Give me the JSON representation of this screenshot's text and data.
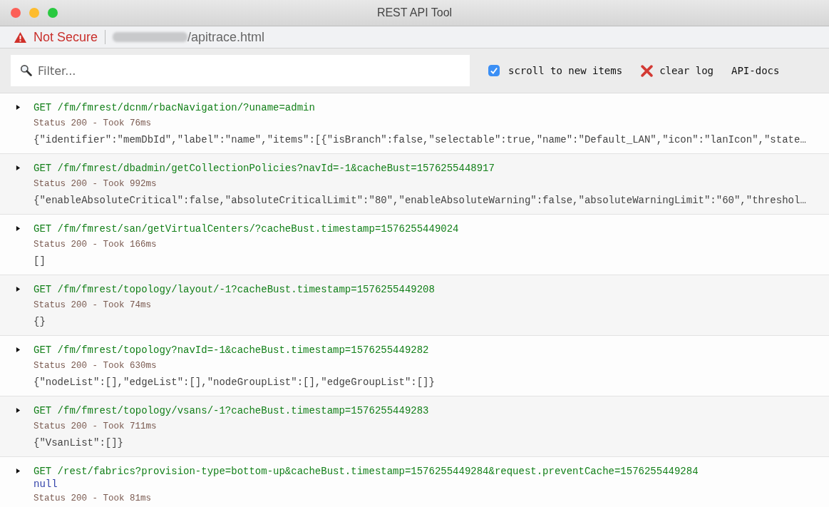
{
  "window": {
    "title": "REST API Tool"
  },
  "address_bar": {
    "security_label": "Not Secure",
    "path": "/apitrace.html"
  },
  "toolbar": {
    "filter": {
      "placeholder": "Filter..."
    },
    "scroll_checkbox": {
      "label": "scroll to new items",
      "checked": true
    },
    "clear_button": {
      "label": "clear log"
    },
    "docs_link": {
      "label": "API-docs"
    }
  },
  "entries": [
    {
      "expanded": false,
      "lines": [
        {
          "kind": "request",
          "text": "GET /fm/fmrest/dcnm/rbacNavigation/?uname=admin"
        },
        {
          "kind": "status",
          "text": "Status 200 - Took 76ms"
        },
        {
          "kind": "body",
          "text": "{\"identifier\":\"memDbId\",\"label\":\"name\",\"items\":[{\"isBranch\":false,\"selectable\":true,\"name\":\"Default_LAN\",\"icon\":\"lanIcon\",\"state…"
        }
      ]
    },
    {
      "expanded": false,
      "lines": [
        {
          "kind": "request",
          "text": "GET /fm/fmrest/dbadmin/getCollectionPolicies?navId=-1&cacheBust=1576255448917"
        },
        {
          "kind": "status",
          "text": "Status 200 - Took 992ms"
        },
        {
          "kind": "body",
          "text": "{\"enableAbsoluteCritical\":false,\"absoluteCriticalLimit\":\"80\",\"enableAbsoluteWarning\":false,\"absoluteWarningLimit\":\"60\",\"threshol…"
        }
      ]
    },
    {
      "expanded": false,
      "lines": [
        {
          "kind": "request",
          "text": "GET /fm/fmrest/san/getVirtualCenters/?cacheBust.timestamp=1576255449024"
        },
        {
          "kind": "status",
          "text": "Status 200 - Took 166ms"
        },
        {
          "kind": "body",
          "text": "[]"
        }
      ]
    },
    {
      "expanded": false,
      "lines": [
        {
          "kind": "request",
          "text": "GET /fm/fmrest/topology/layout/-1?cacheBust.timestamp=1576255449208"
        },
        {
          "kind": "status",
          "text": "Status 200 - Took 74ms"
        },
        {
          "kind": "body",
          "text": "{}"
        }
      ]
    },
    {
      "expanded": false,
      "lines": [
        {
          "kind": "request",
          "text": "GET /fm/fmrest/topology?navId=-1&cacheBust.timestamp=1576255449282"
        },
        {
          "kind": "status",
          "text": "Status 200 - Took 630ms"
        },
        {
          "kind": "body",
          "text": "{\"nodeList\":[],\"edgeList\":[],\"nodeGroupList\":[],\"edgeGroupList\":[]}"
        }
      ]
    },
    {
      "expanded": false,
      "lines": [
        {
          "kind": "request",
          "text": "GET /fm/fmrest/topology/vsans/-1?cacheBust.timestamp=1576255449283"
        },
        {
          "kind": "status",
          "text": "Status 200 - Took 711ms"
        },
        {
          "kind": "body",
          "text": "{\"VsanList\":[]}"
        }
      ]
    },
    {
      "expanded": false,
      "lines": [
        {
          "kind": "request",
          "text": "GET /rest/fabrics?provision-type=bottom-up&cacheBust.timestamp=1576255449284&request.preventCache=1576255449284"
        },
        {
          "kind": "null",
          "text": "null"
        },
        {
          "kind": "status",
          "text": "Status 200 - Took 81ms"
        }
      ]
    }
  ]
}
